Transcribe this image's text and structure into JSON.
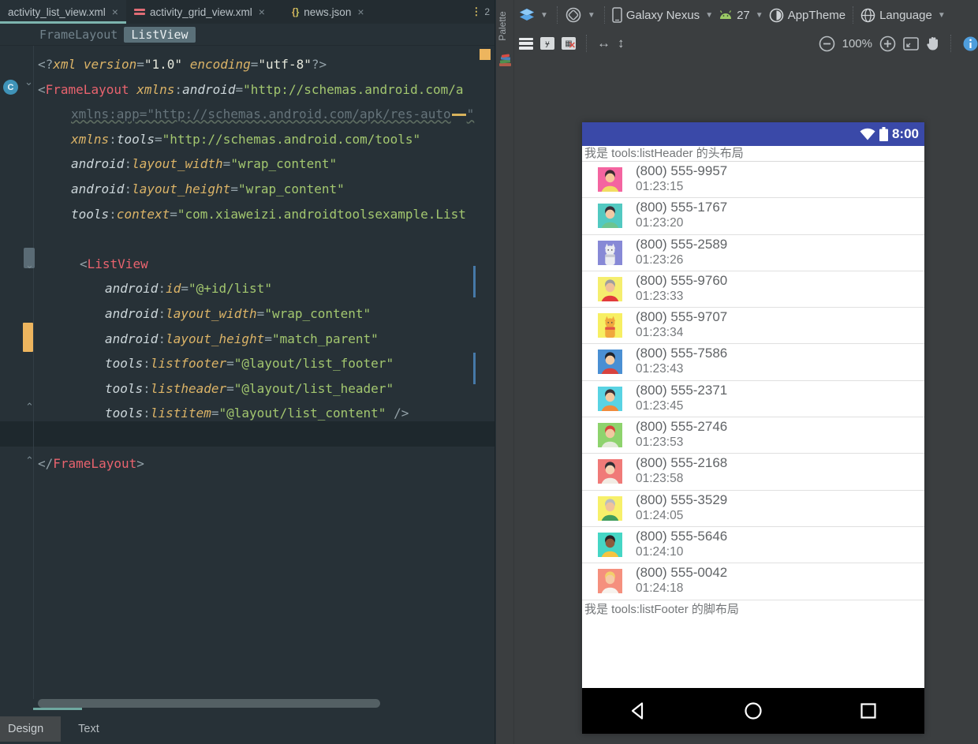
{
  "ide": {
    "tab_bar": {
      "tabs": [
        {
          "label": "activity_list_view.xml",
          "close": "×",
          "active": true
        },
        {
          "label": "activity_grid_view.xml",
          "close": "×",
          "active": false
        },
        {
          "label": "news.json",
          "close": "×",
          "active": false
        }
      ],
      "overflow_count": "2"
    },
    "breadcrumb": {
      "parent": "FrameLayout",
      "selected": "ListView"
    },
    "code": {
      "lines": [
        {
          "indent": 0,
          "tokens": [
            [
              "p",
              "<?"
            ],
            [
              "a",
              "xml"
            ],
            [
              "p",
              " "
            ],
            [
              "a",
              "version"
            ],
            [
              "p",
              "="
            ],
            [
              "w",
              "\"1.0\""
            ],
            [
              "p",
              " "
            ],
            [
              "a",
              "encoding"
            ],
            [
              "p",
              "="
            ],
            [
              "w",
              "\"utf-8\""
            ],
            [
              "p",
              "?>"
            ]
          ]
        },
        {
          "indent": 0,
          "tokens": [
            [
              "p",
              "<"
            ],
            [
              "t",
              "FrameLayout"
            ],
            [
              "p",
              " "
            ],
            [
              "a",
              "xmlns"
            ],
            [
              "p",
              ":"
            ],
            [
              "ns",
              "android"
            ],
            [
              "p",
              "="
            ],
            [
              "v",
              "\"http://schemas.android.com/a"
            ]
          ]
        },
        {
          "indent": 42,
          "unused": true,
          "tokens": [
            [
              "g",
              "xmlns:app=\"http://schemas.android.com/apk/res-auto"
            ],
            [
              "yd",
              ""
            ],
            [
              "g",
              "\""
            ]
          ]
        },
        {
          "indent": 42,
          "tokens": [
            [
              "a",
              "xmlns"
            ],
            [
              "p",
              ":"
            ],
            [
              "ns",
              "tools"
            ],
            [
              "p",
              "="
            ],
            [
              "v",
              "\"http://schemas.android.com/tools\""
            ]
          ]
        },
        {
          "indent": 42,
          "tokens": [
            [
              "ns",
              "android"
            ],
            [
              "p",
              ":"
            ],
            [
              "a",
              "layout_width"
            ],
            [
              "p",
              "="
            ],
            [
              "v",
              "\"wrap_content\""
            ]
          ]
        },
        {
          "indent": 42,
          "tokens": [
            [
              "ns",
              "android"
            ],
            [
              "p",
              ":"
            ],
            [
              "a",
              "layout_height"
            ],
            [
              "p",
              "="
            ],
            [
              "v",
              "\"wrap_content\""
            ]
          ]
        },
        {
          "indent": 42,
          "tokens": [
            [
              "ns",
              "tools"
            ],
            [
              "p",
              ":"
            ],
            [
              "a",
              "context"
            ],
            [
              "p",
              "="
            ],
            [
              "v",
              "\"com.xiaweizi.androidtoolsexample.List"
            ]
          ]
        },
        {
          "indent": 0,
          "tokens": []
        },
        {
          "indent": 53,
          "tokens": [
            [
              "p",
              "<"
            ],
            [
              "t",
              "ListView"
            ]
          ]
        },
        {
          "indent": 85,
          "tokens": [
            [
              "ns",
              "android"
            ],
            [
              "p",
              ":"
            ],
            [
              "a",
              "id"
            ],
            [
              "p",
              "="
            ],
            [
              "v",
              "\"@+id/list\""
            ]
          ]
        },
        {
          "indent": 85,
          "tokens": [
            [
              "ns",
              "android"
            ],
            [
              "p",
              ":"
            ],
            [
              "a",
              "layout_width"
            ],
            [
              "p",
              "="
            ],
            [
              "v",
              "\"wrap_content\""
            ]
          ]
        },
        {
          "indent": 85,
          "tokens": [
            [
              "ns",
              "android"
            ],
            [
              "p",
              ":"
            ],
            [
              "a",
              "layout_height"
            ],
            [
              "p",
              "="
            ],
            [
              "v",
              "\"match_parent\""
            ]
          ]
        },
        {
          "indent": 85,
          "tokens": [
            [
              "ns",
              "tools"
            ],
            [
              "p",
              ":"
            ],
            [
              "a",
              "listfooter"
            ],
            [
              "p",
              "="
            ],
            [
              "v",
              "\"@layout/list_footer\""
            ]
          ]
        },
        {
          "indent": 85,
          "highlight": true,
          "tokens": [
            [
              "ns",
              "tools"
            ],
            [
              "p",
              ":"
            ],
            [
              "a",
              "listheader"
            ],
            [
              "p",
              "="
            ],
            [
              "v",
              "\"@layout/list_header\""
            ]
          ]
        },
        {
          "indent": 85,
          "tokens": [
            [
              "ns",
              "tools"
            ],
            [
              "p",
              ":"
            ],
            [
              "a",
              "listitem"
            ],
            [
              "p",
              "="
            ],
            [
              "v",
              "\"@layout/list_content\""
            ],
            [
              "p",
              " />"
            ]
          ]
        },
        {
          "indent": 0,
          "tokens": []
        },
        {
          "indent": 0,
          "tokens": [
            [
              "p",
              "</"
            ],
            [
              "t",
              "FrameLayout"
            ],
            [
              "p",
              ">"
            ]
          ]
        }
      ]
    },
    "bottom_tabs": {
      "design": "Design",
      "text": "Text"
    }
  },
  "palette": {
    "label": "Palette"
  },
  "preview": {
    "toolbar": {
      "device": "Galaxy Nexus",
      "api_level": "27",
      "theme": "AppTheme",
      "locale": "Language",
      "zoom_level": "100%"
    },
    "phone": {
      "status_time": "8:00",
      "list_header": "我是 tools:listHeader 的头布局",
      "list_footer": "我是 tools:listFooter 的脚布局",
      "contacts": [
        {
          "phone": "(800) 555-9957",
          "time": "01:23:15",
          "avatar": {
            "type": "person",
            "bg": "#f464a0",
            "skin": "#f6c79b",
            "hair": "#3b2a33",
            "shirt": "#f2dd63"
          }
        },
        {
          "phone": "(800) 555-1767",
          "time": "01:23:20",
          "avatar": {
            "type": "person",
            "bg": "#52c9c1",
            "skin": "#f3c9a5",
            "hair": "#343038",
            "shirt": "#6cc48f"
          }
        },
        {
          "phone": "(800) 555-2589",
          "time": "01:23:26",
          "avatar": {
            "type": "cat",
            "bg": "#8789d6",
            "body": "#ecedf1",
            "accent": "#c9cad3"
          }
        },
        {
          "phone": "(800) 555-9760",
          "time": "01:23:33",
          "avatar": {
            "type": "person",
            "bg": "#f5ee6e",
            "skin": "#f0c09a",
            "hair": "#9e9e9e",
            "shirt": "#e23b3b"
          }
        },
        {
          "phone": "(800) 555-9707",
          "time": "01:23:34",
          "avatar": {
            "type": "cat",
            "bg": "#f7ef63",
            "body": "#f0a73e",
            "accent": "#e25247"
          }
        },
        {
          "phone": "(800) 555-7586",
          "time": "01:23:43",
          "avatar": {
            "type": "person",
            "bg": "#4a8fd3",
            "skin": "#f6cda6",
            "hair": "#20242c",
            "shirt": "#d8433f"
          }
        },
        {
          "phone": "(800) 555-2371",
          "time": "01:23:45",
          "avatar": {
            "type": "person",
            "bg": "#59d3e3",
            "skin": "#f4c9a1",
            "hair": "#3a3136",
            "shirt": "#f08a3c"
          }
        },
        {
          "phone": "(800) 555-2746",
          "time": "01:23:53",
          "avatar": {
            "type": "person",
            "bg": "#8ed36d",
            "skin": "#f2c9a0",
            "hair": "#d8443c",
            "shirt": "#e3ead9"
          }
        },
        {
          "phone": "(800) 555-2168",
          "time": "01:23:58",
          "avatar": {
            "type": "person",
            "bg": "#f07a78",
            "skin": "#f6d3b4",
            "hair": "#2e2e34",
            "shirt": "#f2ece4"
          }
        },
        {
          "phone": "(800) 555-3529",
          "time": "01:24:05",
          "avatar": {
            "type": "person",
            "bg": "#f7f06a",
            "skin": "#f0c29c",
            "hair": "#b9bdbf",
            "shirt": "#3f9c5d"
          }
        },
        {
          "phone": "(800) 555-5646",
          "time": "01:24:10",
          "avatar": {
            "type": "person",
            "bg": "#45d6c5",
            "skin": "#8d5a3c",
            "hair": "#252226",
            "shirt": "#f5c440"
          }
        },
        {
          "phone": "(800) 555-0042",
          "time": "01:24:18",
          "avatar": {
            "type": "person",
            "bg": "#f5907e",
            "skin": "#f6cba6",
            "hair": "#f3d06b",
            "shirt": "#f7f3ee"
          }
        }
      ]
    }
  },
  "colors": {
    "accent_teal": "#7db4ae",
    "status_bar_blue": "#3a49a8",
    "editor_bg": "#273137",
    "preview_bg": "#3b3e40",
    "info_blue": "#4f9edd"
  }
}
